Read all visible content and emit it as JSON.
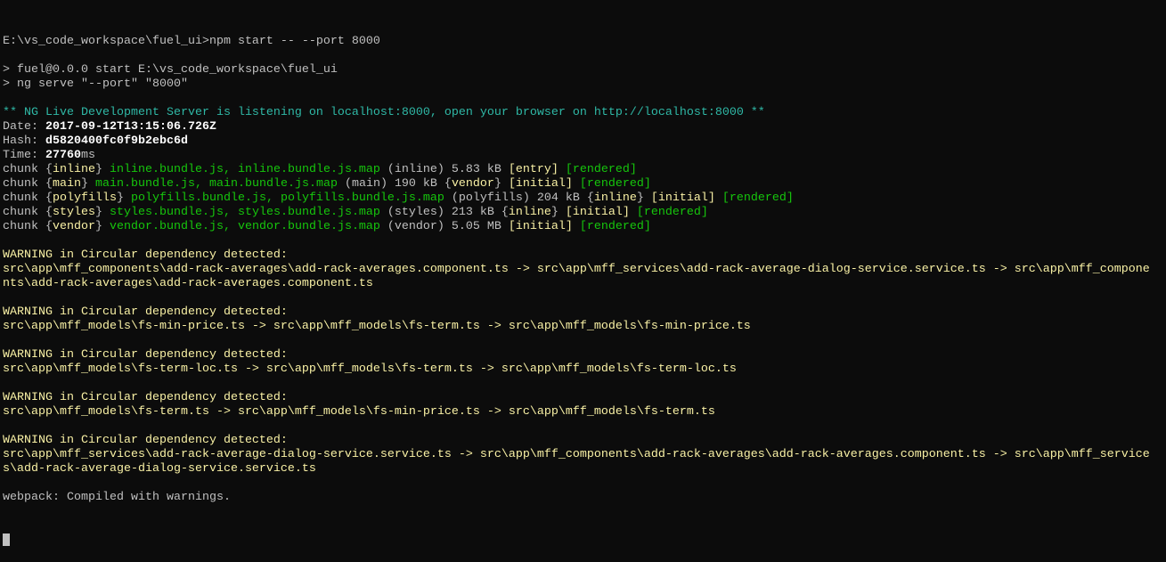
{
  "colors": {
    "background": "#0c0c0c",
    "text_default": "#c0c0c0",
    "text_bright": "#ffffff",
    "green": "#16c60c",
    "teal": "#2fb8a6",
    "yellow": "#f9f1a5"
  },
  "lines": [
    {
      "segs": [
        {
          "t": "E:\\vs_code_workspace\\fuel_ui>npm start -- --port 8000",
          "c": "c-gray"
        }
      ]
    },
    {
      "segs": [
        {
          "t": "",
          "c": "c-gray"
        }
      ]
    },
    {
      "segs": [
        {
          "t": "> fuel@0.0.0 start E:\\vs_code_workspace\\fuel_ui",
          "c": "c-gray"
        }
      ]
    },
    {
      "segs": [
        {
          "t": "> ng serve \"--port\" \"8000\"",
          "c": "c-gray"
        }
      ]
    },
    {
      "segs": [
        {
          "t": "",
          "c": "c-gray"
        }
      ]
    },
    {
      "segs": [
        {
          "t": "** NG Live Development Server is listening on localhost:8000, open your browser on http://localhost:8000 **",
          "c": "c-teal"
        }
      ]
    },
    {
      "segs": [
        {
          "t": "Date: ",
          "c": "c-gray"
        },
        {
          "t": "2017-09-12T13:15:06.726Z",
          "c": "c-white-bold"
        }
      ]
    },
    {
      "segs": [
        {
          "t": "Hash: ",
          "c": "c-gray"
        },
        {
          "t": "d5820400fc0f9b2ebc6d",
          "c": "c-white-bold"
        }
      ]
    },
    {
      "segs": [
        {
          "t": "Time: ",
          "c": "c-gray"
        },
        {
          "t": "27760",
          "c": "c-white-bold"
        },
        {
          "t": "ms",
          "c": "c-gray"
        }
      ]
    },
    {
      "segs": [
        {
          "t": "chunk {",
          "c": "c-gray"
        },
        {
          "t": "inline",
          "c": "c-byellow"
        },
        {
          "t": "} ",
          "c": "c-gray"
        },
        {
          "t": "inline.bundle.js, inline.bundle.js.map",
          "c": "c-bgreen"
        },
        {
          "t": " (inline) 5.83 kB ",
          "c": "c-gray"
        },
        {
          "t": "[entry]",
          "c": "c-byellow"
        },
        {
          "t": " ",
          "c": "c-gray"
        },
        {
          "t": "[rendered]",
          "c": "c-bgreen"
        }
      ]
    },
    {
      "segs": [
        {
          "t": "chunk {",
          "c": "c-gray"
        },
        {
          "t": "main",
          "c": "c-byellow"
        },
        {
          "t": "} ",
          "c": "c-gray"
        },
        {
          "t": "main.bundle.js, main.bundle.js.map",
          "c": "c-bgreen"
        },
        {
          "t": " (main) 190 kB {",
          "c": "c-gray"
        },
        {
          "t": "vendor",
          "c": "c-byellow"
        },
        {
          "t": "} ",
          "c": "c-gray"
        },
        {
          "t": "[initial]",
          "c": "c-byellow"
        },
        {
          "t": " ",
          "c": "c-gray"
        },
        {
          "t": "[rendered]",
          "c": "c-bgreen"
        }
      ]
    },
    {
      "segs": [
        {
          "t": "chunk {",
          "c": "c-gray"
        },
        {
          "t": "polyfills",
          "c": "c-byellow"
        },
        {
          "t": "} ",
          "c": "c-gray"
        },
        {
          "t": "polyfills.bundle.js, polyfills.bundle.js.map",
          "c": "c-bgreen"
        },
        {
          "t": " (polyfills) 204 kB {",
          "c": "c-gray"
        },
        {
          "t": "inline",
          "c": "c-byellow"
        },
        {
          "t": "} ",
          "c": "c-gray"
        },
        {
          "t": "[initial]",
          "c": "c-byellow"
        },
        {
          "t": " ",
          "c": "c-gray"
        },
        {
          "t": "[rendered]",
          "c": "c-bgreen"
        }
      ]
    },
    {
      "segs": [
        {
          "t": "chunk {",
          "c": "c-gray"
        },
        {
          "t": "styles",
          "c": "c-byellow"
        },
        {
          "t": "} ",
          "c": "c-gray"
        },
        {
          "t": "styles.bundle.js, styles.bundle.js.map",
          "c": "c-bgreen"
        },
        {
          "t": " (styles) 213 kB {",
          "c": "c-gray"
        },
        {
          "t": "inline",
          "c": "c-byellow"
        },
        {
          "t": "} ",
          "c": "c-gray"
        },
        {
          "t": "[initial]",
          "c": "c-byellow"
        },
        {
          "t": " ",
          "c": "c-gray"
        },
        {
          "t": "[rendered]",
          "c": "c-bgreen"
        }
      ]
    },
    {
      "segs": [
        {
          "t": "chunk {",
          "c": "c-gray"
        },
        {
          "t": "vendor",
          "c": "c-byellow"
        },
        {
          "t": "} ",
          "c": "c-gray"
        },
        {
          "t": "vendor.bundle.js, vendor.bundle.js.map",
          "c": "c-bgreen"
        },
        {
          "t": " (vendor) 5.05 MB ",
          "c": "c-gray"
        },
        {
          "t": "[initial]",
          "c": "c-byellow"
        },
        {
          "t": " ",
          "c": "c-gray"
        },
        {
          "t": "[rendered]",
          "c": "c-bgreen"
        }
      ]
    },
    {
      "segs": [
        {
          "t": "",
          "c": "c-gray"
        }
      ]
    },
    {
      "segs": [
        {
          "t": "WARNING in Circular dependency detected:",
          "c": "c-yellow"
        }
      ]
    },
    {
      "segs": [
        {
          "t": "src\\app\\mff_components\\add-rack-averages\\add-rack-averages.component.ts -> src\\app\\mff_services\\add-rack-average-dialog-service.service.ts -> src\\app\\mff_compone",
          "c": "c-yellow"
        }
      ]
    },
    {
      "segs": [
        {
          "t": "nts\\add-rack-averages\\add-rack-averages.component.ts",
          "c": "c-yellow"
        }
      ]
    },
    {
      "segs": [
        {
          "t": "",
          "c": "c-gray"
        }
      ]
    },
    {
      "segs": [
        {
          "t": "WARNING in Circular dependency detected:",
          "c": "c-yellow"
        }
      ]
    },
    {
      "segs": [
        {
          "t": "src\\app\\mff_models\\fs-min-price.ts -> src\\app\\mff_models\\fs-term.ts -> src\\app\\mff_models\\fs-min-price.ts",
          "c": "c-yellow"
        }
      ]
    },
    {
      "segs": [
        {
          "t": "",
          "c": "c-gray"
        }
      ]
    },
    {
      "segs": [
        {
          "t": "WARNING in Circular dependency detected:",
          "c": "c-yellow"
        }
      ]
    },
    {
      "segs": [
        {
          "t": "src\\app\\mff_models\\fs-term-loc.ts -> src\\app\\mff_models\\fs-term.ts -> src\\app\\mff_models\\fs-term-loc.ts",
          "c": "c-yellow"
        }
      ]
    },
    {
      "segs": [
        {
          "t": "",
          "c": "c-gray"
        }
      ]
    },
    {
      "segs": [
        {
          "t": "WARNING in Circular dependency detected:",
          "c": "c-yellow"
        }
      ]
    },
    {
      "segs": [
        {
          "t": "src\\app\\mff_models\\fs-term.ts -> src\\app\\mff_models\\fs-min-price.ts -> src\\app\\mff_models\\fs-term.ts",
          "c": "c-yellow"
        }
      ]
    },
    {
      "segs": [
        {
          "t": "",
          "c": "c-gray"
        }
      ]
    },
    {
      "segs": [
        {
          "t": "WARNING in Circular dependency detected:",
          "c": "c-yellow"
        }
      ]
    },
    {
      "segs": [
        {
          "t": "src\\app\\mff_services\\add-rack-average-dialog-service.service.ts -> src\\app\\mff_components\\add-rack-averages\\add-rack-averages.component.ts -> src\\app\\mff_service",
          "c": "c-yellow"
        }
      ]
    },
    {
      "segs": [
        {
          "t": "s\\add-rack-average-dialog-service.service.ts",
          "c": "c-yellow"
        }
      ]
    },
    {
      "segs": [
        {
          "t": "",
          "c": "c-gray"
        }
      ]
    },
    {
      "segs": [
        {
          "t": "webpack: Compiled with warnings.",
          "c": "c-gray"
        }
      ]
    }
  ]
}
